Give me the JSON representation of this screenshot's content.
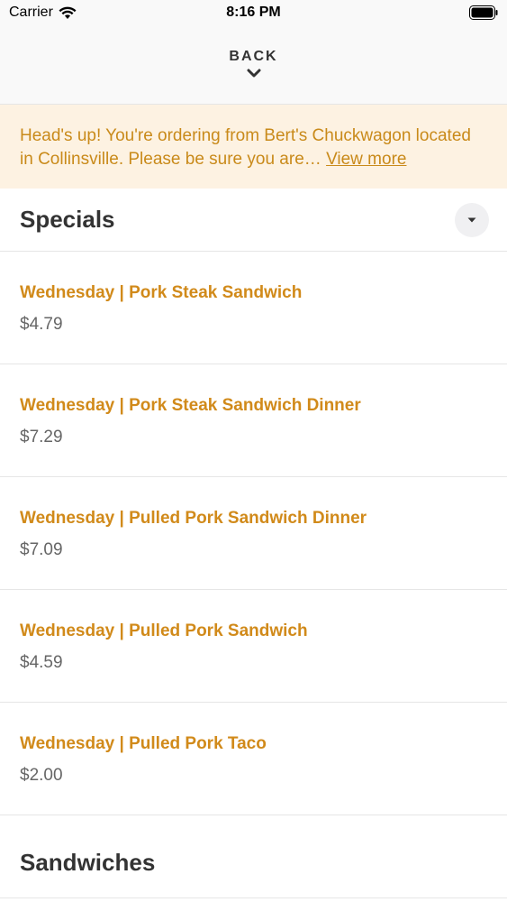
{
  "status_bar": {
    "carrier": "Carrier",
    "time": "8:16 PM"
  },
  "header": {
    "back_label": "BACK"
  },
  "notice": {
    "text": "Head's up! You're ordering from Bert's Chuckwagon located in Collinsville. Please be sure you are… ",
    "link": "View more"
  },
  "sections": {
    "specials": {
      "title": "Specials",
      "items": [
        {
          "name": "Wednesday | Pork Steak Sandwich",
          "price": "$4.79"
        },
        {
          "name": "Wednesday | Pork Steak Sandwich Dinner",
          "price": "$7.29"
        },
        {
          "name": "Wednesday | Pulled Pork Sandwich Dinner",
          "price": "$7.09"
        },
        {
          "name": "Wednesday | Pulled Pork Sandwich",
          "price": "$4.59"
        },
        {
          "name": "Wednesday | Pulled Pork Taco",
          "price": "$2.00"
        }
      ]
    },
    "sandwiches": {
      "title": "Sandwiches"
    }
  },
  "colors": {
    "accent": "#d18a1a",
    "notice_bg": "#fdf2e2",
    "notice_text": "#c98a1a"
  },
  "icons": {
    "wifi": "wifi-icon",
    "battery": "battery-icon",
    "back_chevron": "chevron-down-icon",
    "toggle": "caret-down-icon"
  }
}
